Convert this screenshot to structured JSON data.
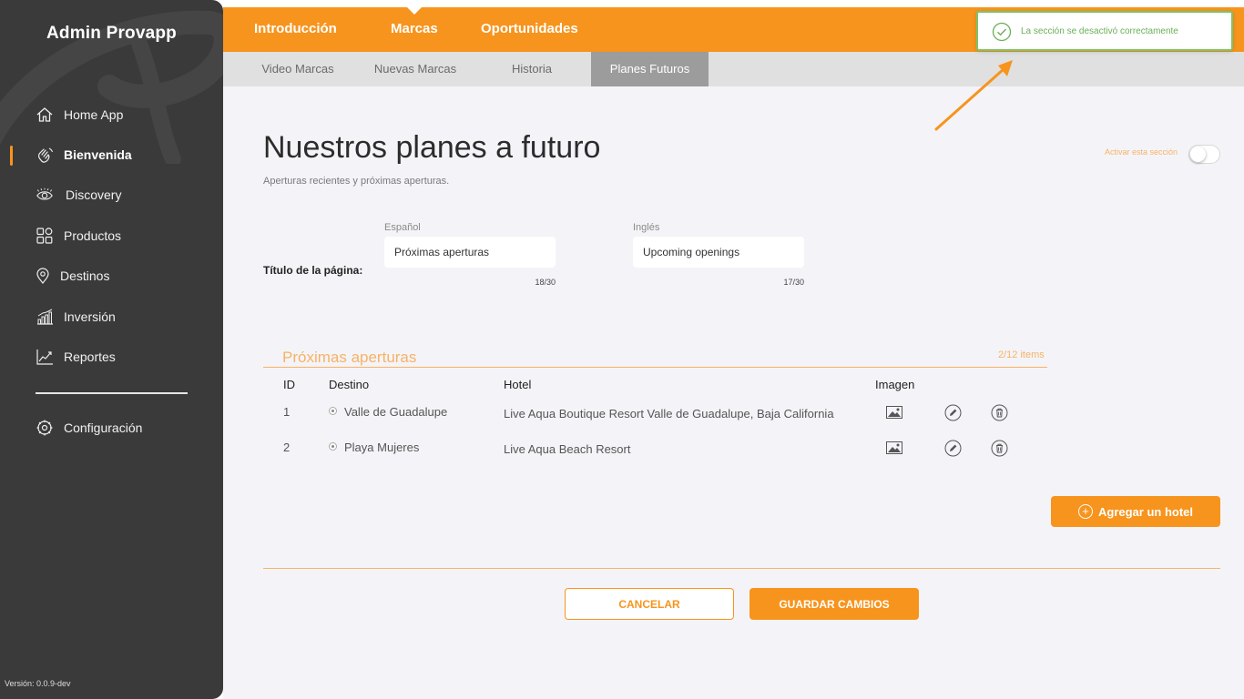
{
  "sidebar": {
    "app_title": "Admin Provapp",
    "items": [
      {
        "label": "Home App",
        "icon": "home-icon"
      },
      {
        "label": "Bienvenida",
        "icon": "wave-hand-icon",
        "active": true
      },
      {
        "label": "Discovery",
        "icon": "eye-icon"
      },
      {
        "label": "Productos",
        "icon": "products-icon"
      },
      {
        "label": "Destinos",
        "icon": "location-pin-icon"
      },
      {
        "label": "Inversión",
        "icon": "bar-chart-icon"
      },
      {
        "label": "Reportes",
        "icon": "line-chart-icon"
      }
    ],
    "settings_label": "Configuración",
    "version": "Versión: 0.0.9-dev"
  },
  "topnav": {
    "tabs": [
      "Introducción",
      "Marcas",
      "Oportunidades"
    ],
    "active_tab": "Marcas"
  },
  "subnav": {
    "tabs": [
      "Video Marcas",
      "Nuevas Marcas",
      "Historia",
      "Planes Futuros"
    ],
    "active_tab": "Planes Futuros"
  },
  "toast": {
    "message": "La sección se desactivó correctamente",
    "color": "#7cc46a"
  },
  "page": {
    "title": "Nuestros planes a futuro",
    "subtitle": "Aperturas recientes y próximas aperturas.",
    "toggle_label": "Activar esta sección",
    "toggle_on": false
  },
  "form": {
    "field_label": "Título de la página:",
    "spanish": {
      "label": "Español",
      "value": "Próximas aperturas",
      "counter": "18/30"
    },
    "english": {
      "label": "Inglés",
      "value": "Upcoming openings",
      "counter": "17/30"
    }
  },
  "section": {
    "title": "Próximas aperturas",
    "count": "2/12 items",
    "columns": [
      "ID",
      "Destino",
      "Hotel",
      "Imagen"
    ],
    "rows": [
      {
        "id": "1",
        "destino": "Valle de Guadalupe",
        "hotel": "Live Aqua Boutique Resort Valle de Guadalupe, Baja California"
      },
      {
        "id": "2",
        "destino": "Playa Mujeres",
        "hotel": "Live Aqua Beach Resort"
      }
    ],
    "add_button": "Agregar un hotel"
  },
  "actions": {
    "cancel": "CANCELAR",
    "save": "GUARDAR CAMBIOS"
  },
  "colors": {
    "accent": "#f7941d",
    "sidebar_bg": "#3a3a3a",
    "success": "#7cc46a"
  }
}
